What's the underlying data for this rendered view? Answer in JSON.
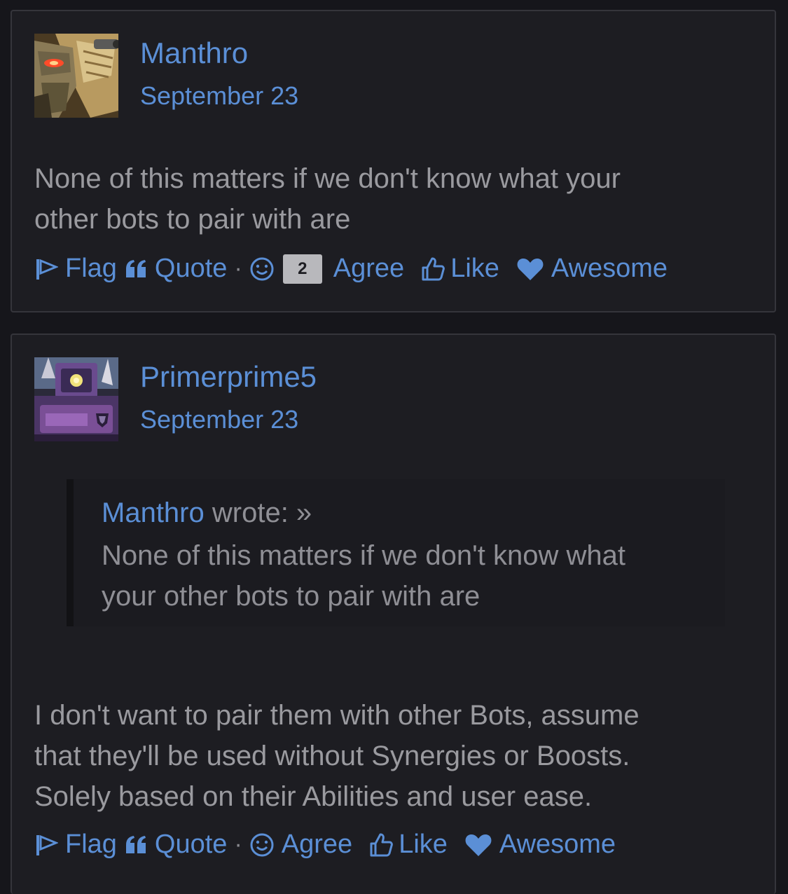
{
  "posts": [
    {
      "username": "Manthro",
      "date": "September 23",
      "avatar_icon": "bird-robot-avatar",
      "body": [
        "None of this matters if we don't know what your",
        "other bots to pair with are"
      ],
      "actions": {
        "flag": "Flag",
        "quote": "Quote",
        "separator": "·",
        "reaction_count": "2",
        "agree": "Agree",
        "like": "Like",
        "awesome": "Awesome"
      }
    },
    {
      "username": "Primerprime5",
      "date": "September 23",
      "avatar_icon": "purple-robot-avatar",
      "quote": {
        "author": "Manthro",
        "wrote": "wrote: »",
        "body": [
          "None of this matters if we don't know what",
          "your other bots to pair with are"
        ]
      },
      "body": [
        "I don't want to pair them with other Bots, assume",
        "that they'll be used without Synergies or Boosts.",
        "Solely based on their Abilities and user ease."
      ],
      "actions": {
        "flag": "Flag",
        "quote": "Quote",
        "separator": "·",
        "agree": "Agree",
        "like": "Like",
        "awesome": "Awesome"
      }
    }
  ],
  "colors": {
    "link": "#5b8fd6",
    "text": "#9a9a9f",
    "background": "#16161b",
    "card": "#1d1d22"
  }
}
